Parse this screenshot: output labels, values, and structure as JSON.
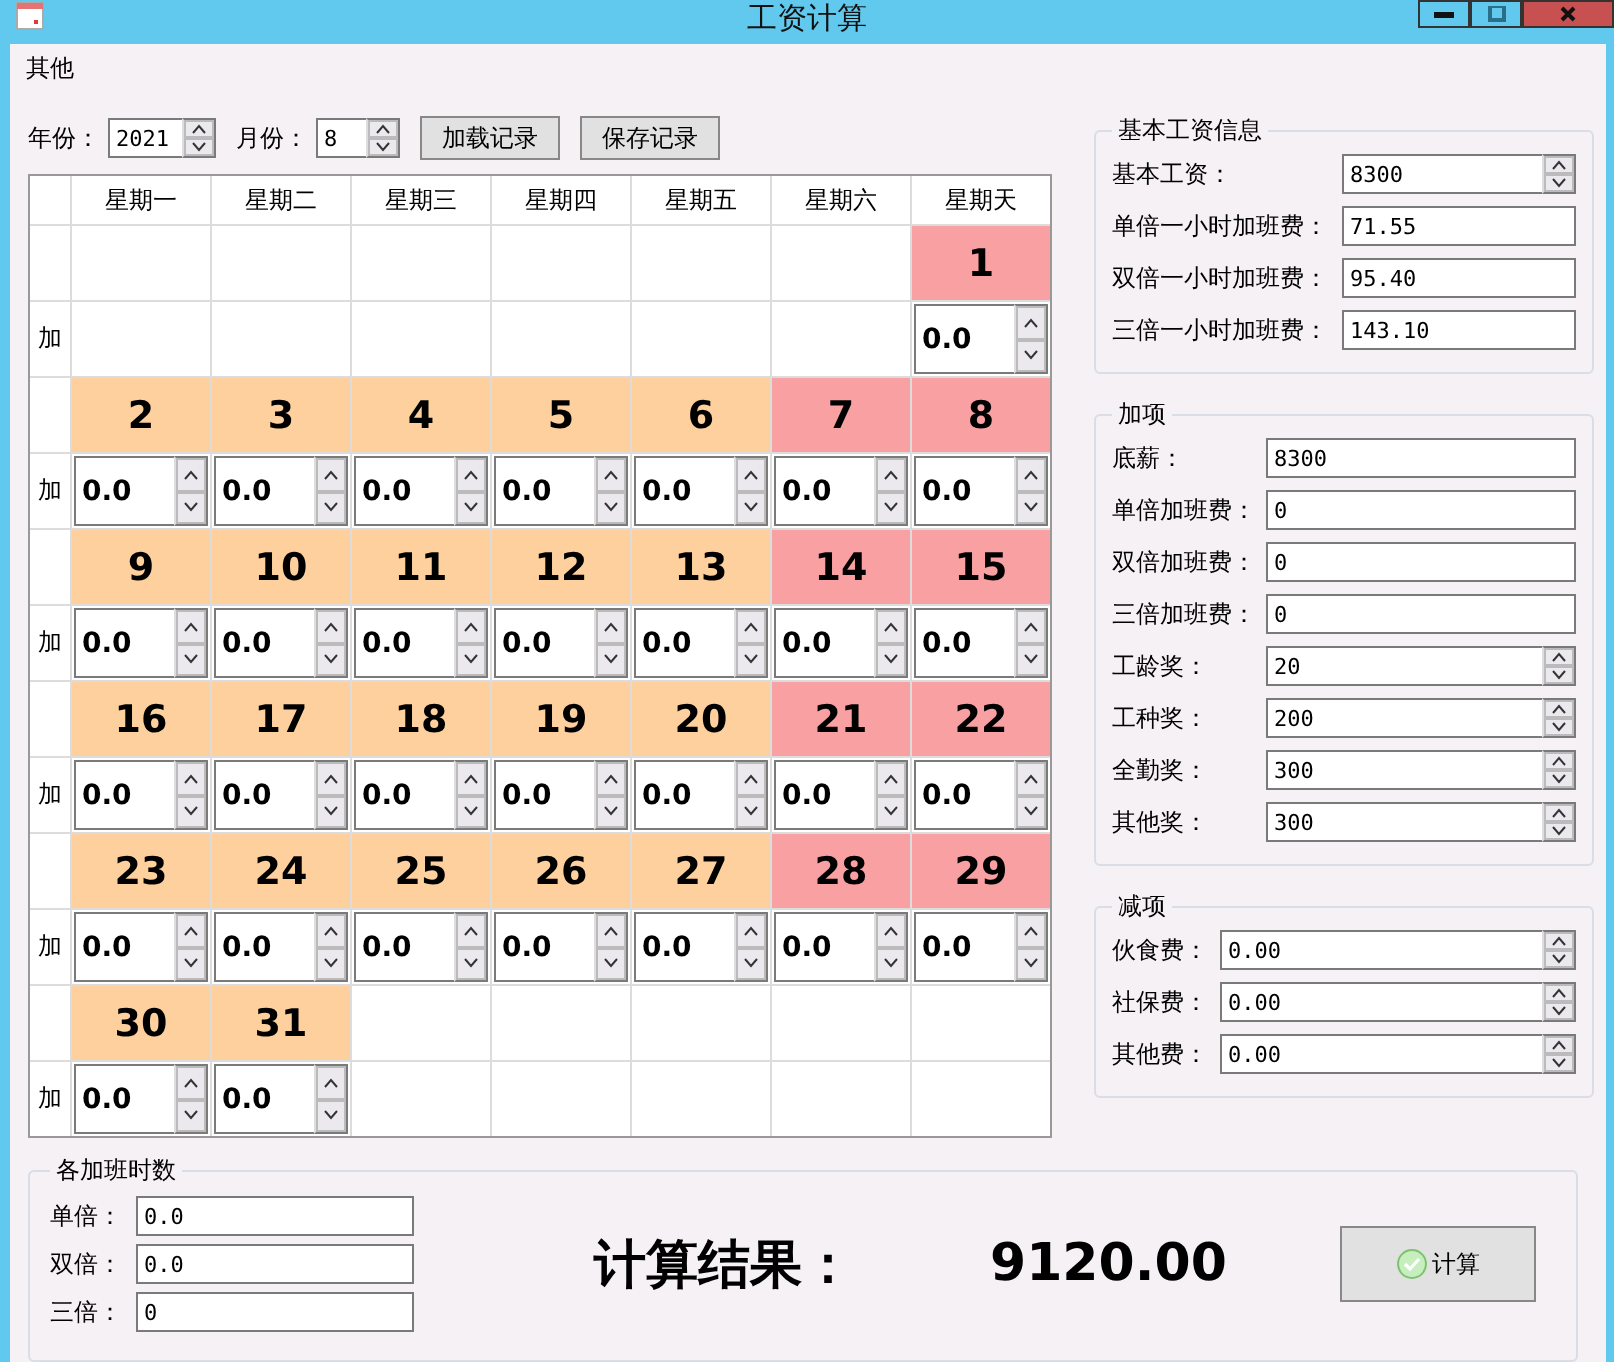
{
  "window": {
    "title": "工资计算"
  },
  "menu": [
    "其他"
  ],
  "toolbar": {
    "year_label": "年份：",
    "year": "2021",
    "month_label": "月份：",
    "month": "8",
    "buttons": [
      "加载记录",
      "保存记录"
    ]
  },
  "calendar": {
    "weekdays": [
      "星期一",
      "星期二",
      "星期三",
      "星期四",
      "星期五",
      "星期六",
      "星期天"
    ],
    "weeks": [
      {
        "row_label": "加",
        "days": [
          {
            "kind": "blank"
          },
          {
            "kind": "blank"
          },
          {
            "kind": "blank"
          },
          {
            "kind": "blank"
          },
          {
            "kind": "blank"
          },
          {
            "kind": "blank"
          },
          {
            "kind": "day",
            "day": "1",
            "weekend": true,
            "hours": "0.0"
          }
        ]
      },
      {
        "row_label": "加",
        "days": [
          {
            "kind": "day",
            "day": "2",
            "weekend": false,
            "hours": "0.0"
          },
          {
            "kind": "day",
            "day": "3",
            "weekend": false,
            "hours": "0.0"
          },
          {
            "kind": "day",
            "day": "4",
            "weekend": false,
            "hours": "0.0"
          },
          {
            "kind": "day",
            "day": "5",
            "weekend": false,
            "hours": "0.0"
          },
          {
            "kind": "day",
            "day": "6",
            "weekend": false,
            "hours": "0.0"
          },
          {
            "kind": "day",
            "day": "7",
            "weekend": true,
            "hours": "0.0"
          },
          {
            "kind": "day",
            "day": "8",
            "weekend": true,
            "hours": "0.0"
          }
        ]
      },
      {
        "row_label": "加",
        "days": [
          {
            "kind": "day",
            "day": "9",
            "weekend": false,
            "hours": "0.0"
          },
          {
            "kind": "day",
            "day": "10",
            "weekend": false,
            "hours": "0.0"
          },
          {
            "kind": "day",
            "day": "11",
            "weekend": false,
            "hours": "0.0"
          },
          {
            "kind": "day",
            "day": "12",
            "weekend": false,
            "hours": "0.0"
          },
          {
            "kind": "day",
            "day": "13",
            "weekend": false,
            "hours": "0.0"
          },
          {
            "kind": "day",
            "day": "14",
            "weekend": true,
            "hours": "0.0"
          },
          {
            "kind": "day",
            "day": "15",
            "weekend": true,
            "hours": "0.0"
          }
        ]
      },
      {
        "row_label": "加",
        "days": [
          {
            "kind": "day",
            "day": "16",
            "weekend": false,
            "hours": "0.0"
          },
          {
            "kind": "day",
            "day": "17",
            "weekend": false,
            "hours": "0.0"
          },
          {
            "kind": "day",
            "day": "18",
            "weekend": false,
            "hours": "0.0"
          },
          {
            "kind": "day",
            "day": "19",
            "weekend": false,
            "hours": "0.0"
          },
          {
            "kind": "day",
            "day": "20",
            "weekend": false,
            "hours": "0.0"
          },
          {
            "kind": "day",
            "day": "21",
            "weekend": true,
            "hours": "0.0"
          },
          {
            "kind": "day",
            "day": "22",
            "weekend": true,
            "hours": "0.0"
          }
        ]
      },
      {
        "row_label": "加",
        "days": [
          {
            "kind": "day",
            "day": "23",
            "weekend": false,
            "hours": "0.0"
          },
          {
            "kind": "day",
            "day": "24",
            "weekend": false,
            "hours": "0.0"
          },
          {
            "kind": "day",
            "day": "25",
            "weekend": false,
            "hours": "0.0"
          },
          {
            "kind": "day",
            "day": "26",
            "weekend": false,
            "hours": "0.0"
          },
          {
            "kind": "day",
            "day": "27",
            "weekend": false,
            "hours": "0.0"
          },
          {
            "kind": "day",
            "day": "28",
            "weekend": true,
            "hours": "0.0"
          },
          {
            "kind": "day",
            "day": "29",
            "weekend": true,
            "hours": "0.0"
          }
        ]
      },
      {
        "row_label": "加",
        "days": [
          {
            "kind": "day",
            "day": "30",
            "weekend": false,
            "hours": "0.0"
          },
          {
            "kind": "day",
            "day": "31",
            "weekend": false,
            "hours": "0.0"
          },
          {
            "kind": "blank"
          },
          {
            "kind": "blank"
          },
          {
            "kind": "blank"
          },
          {
            "kind": "blank"
          },
          {
            "kind": "blank"
          }
        ]
      }
    ]
  },
  "basic": {
    "title": "基本工资信息",
    "fields": [
      {
        "label": "基本工资：",
        "value": "8300",
        "kind": "spin"
      },
      {
        "label": "单倍一小时加班费：",
        "value": "71.55",
        "kind": "text"
      },
      {
        "label": "双倍一小时加班费：",
        "value": "95.40",
        "kind": "text"
      },
      {
        "label": "三倍一小时加班费：",
        "value": "143.10",
        "kind": "text"
      }
    ]
  },
  "additions": {
    "title": "加项",
    "fields": [
      {
        "label": "底薪：",
        "value": "8300",
        "kind": "text"
      },
      {
        "label": "单倍加班费：",
        "value": "0",
        "kind": "text"
      },
      {
        "label": "双倍加班费：",
        "value": "0",
        "kind": "text"
      },
      {
        "label": "三倍加班费：",
        "value": "0",
        "kind": "text"
      },
      {
        "label": "工龄奖：",
        "value": "20",
        "kind": "spin"
      },
      {
        "label": "工种奖：",
        "value": "200",
        "kind": "spin"
      },
      {
        "label": "全勤奖：",
        "value": "300",
        "kind": "spin"
      },
      {
        "label": "其他奖：",
        "value": "300",
        "kind": "spin"
      }
    ]
  },
  "deductions": {
    "title": "减项",
    "fields": [
      {
        "label": "伙食费：",
        "value": "0.00",
        "kind": "spin"
      },
      {
        "label": "社保费：",
        "value": "0.00",
        "kind": "spin"
      },
      {
        "label": "其他费：",
        "value": "0.00",
        "kind": "spin"
      }
    ]
  },
  "overtime_hours": {
    "title": "各加班时数",
    "fields": [
      {
        "label": "单倍：",
        "value": "0.0",
        "kind": "text"
      },
      {
        "label": "双倍：",
        "value": "0.0",
        "kind": "text"
      },
      {
        "label": "三倍：",
        "value": "0",
        "kind": "text"
      }
    ]
  },
  "result": {
    "label": "计算结果：",
    "value": "9120.00"
  },
  "calculate_button": "计算"
}
